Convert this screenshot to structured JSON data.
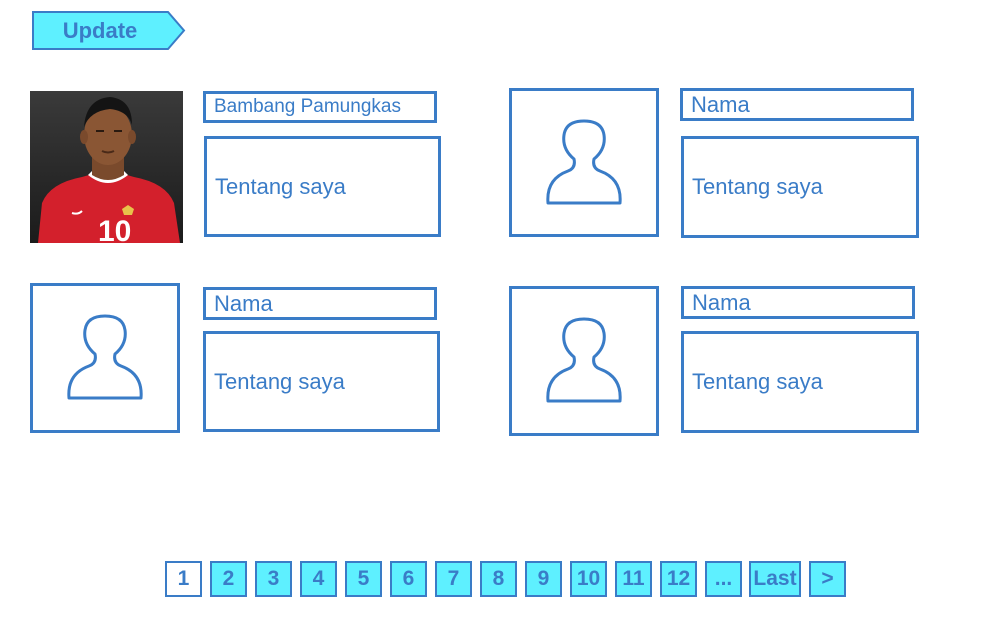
{
  "toolbar": {
    "update_label": "Update"
  },
  "colors": {
    "accent": "#3a7cc7",
    "button_fill": "#5ef0ff",
    "jersey_red": "#d3202c"
  },
  "profiles": [
    {
      "name": "Bambang Pamungkas",
      "about": "Tentang saya",
      "photo": "player-photo",
      "jersey_number": "10"
    },
    {
      "name": "Nama",
      "about": "Tentang saya",
      "photo": "user-silhouette-icon"
    },
    {
      "name": "Nama",
      "about": "Tentang saya",
      "photo": "user-silhouette-icon"
    },
    {
      "name": "Nama",
      "about": "Tentang saya",
      "photo": "user-silhouette-icon"
    }
  ],
  "pagination": {
    "current": "1",
    "pages": [
      "1",
      "2",
      "3",
      "4",
      "5",
      "6",
      "7",
      "8",
      "9",
      "10",
      "11",
      "12"
    ],
    "ellipsis": "...",
    "last": "Last",
    "next": ">"
  }
}
